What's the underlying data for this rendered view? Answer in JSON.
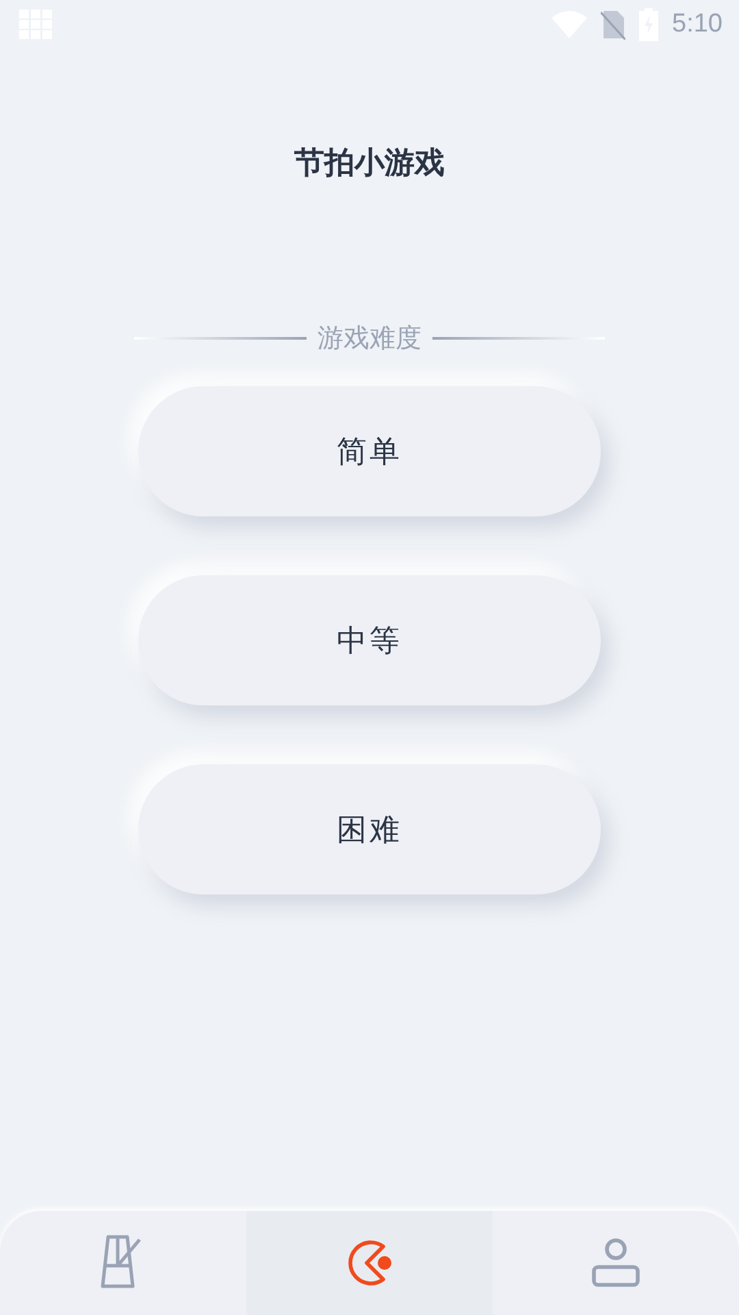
{
  "status_bar": {
    "time": "5:10"
  },
  "title": "节拍小游戏",
  "section_label": "游戏难度",
  "levels": [
    "简单",
    "中等",
    "困难"
  ],
  "tabs": [
    {
      "kind": "metronome",
      "selected": false
    },
    {
      "kind": "game",
      "selected": true
    },
    {
      "kind": "profile",
      "selected": false
    }
  ]
}
